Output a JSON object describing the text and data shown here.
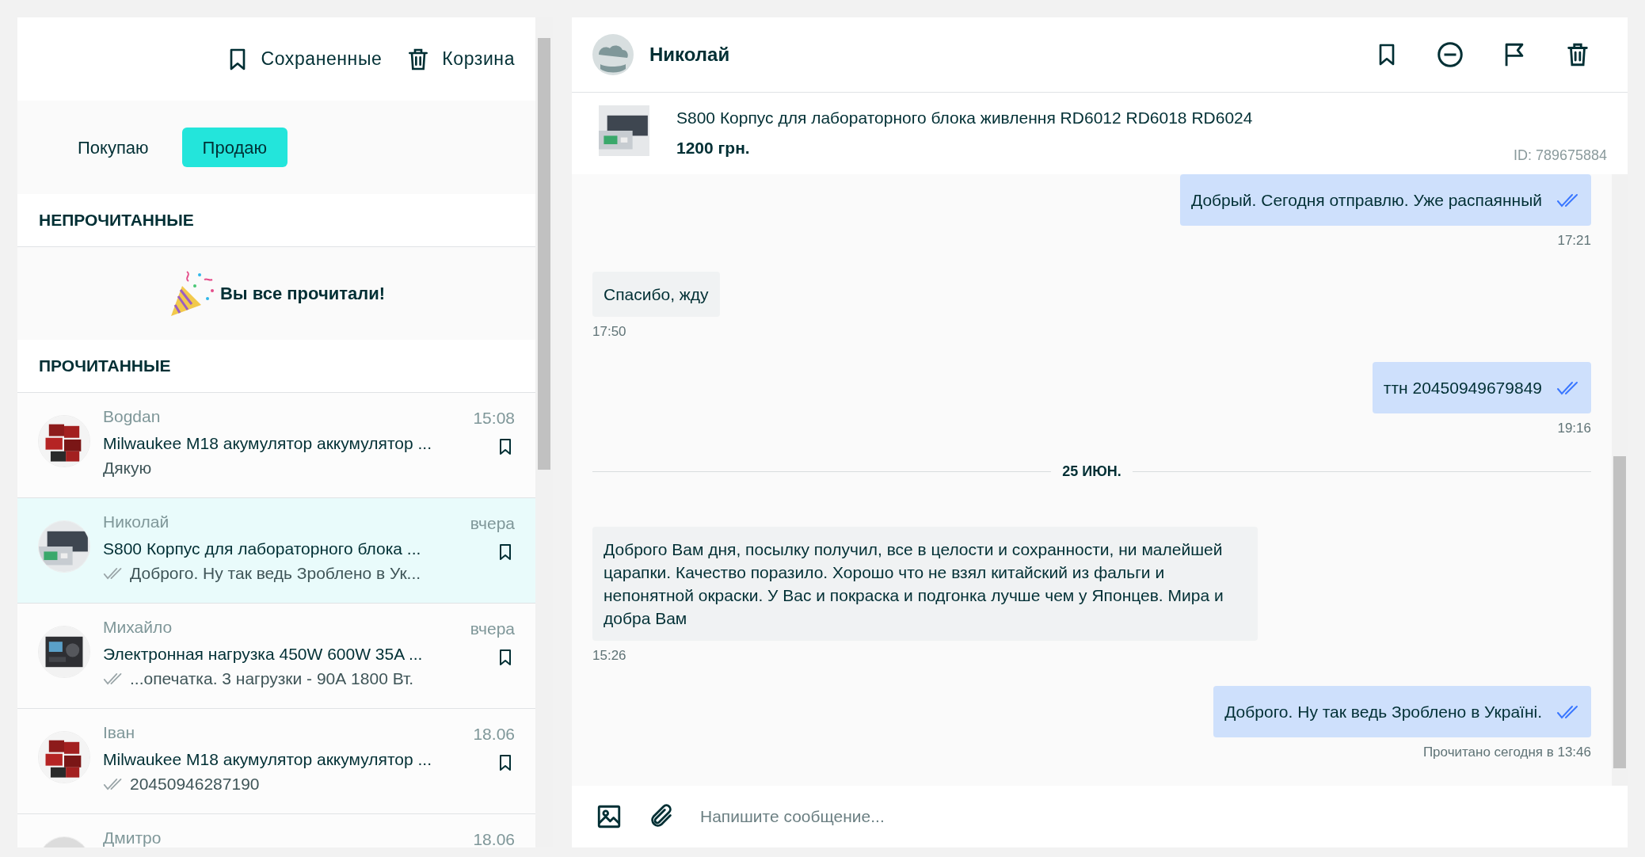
{
  "sidebar": {
    "links": [
      {
        "kind": "bookmark",
        "label": "Сохраненные"
      },
      {
        "kind": "trash",
        "label": "Корзина"
      }
    ],
    "tabs": [
      {
        "label": "Покупаю",
        "selected": false
      },
      {
        "label": "Продаю",
        "selected": true
      }
    ],
    "unread_heading": "НЕПРОЧИТАННЫЕ",
    "all_read_text": "Вы все прочитали!",
    "read_heading": "ПРОЧИТАННЫЕ",
    "conversations": [
      {
        "name": "Bogdan",
        "time": "15:08",
        "title": "Milwaukee M18 акумулятор аккумулятор ...",
        "last": "Дякую",
        "ticked": false,
        "selected": false
      },
      {
        "name": "Николай",
        "time": "вчера",
        "title": "S800 Корпус для лабораторного блока ...",
        "last": "Доброго. Ну так ведь Зроблено в Ук...",
        "ticked": true,
        "selected": true
      },
      {
        "name": "Михайло",
        "time": "вчера",
        "title": "Электронная нагрузка 450W 600W 35A ...",
        "last": "...опечатка. 3 нагрузки - 90А 1800 Вт.",
        "ticked": true,
        "selected": false
      },
      {
        "name": "Іван",
        "time": "18.06",
        "title": "Milwaukee M18 акумулятор аккумулятор ...",
        "last": "20450946287190",
        "ticked": true,
        "selected": false
      },
      {
        "name": "Дмитро",
        "time": "18.06",
        "selected": false
      }
    ]
  },
  "chat": {
    "contact": "Николай",
    "product": {
      "title": "S800 Корпус для лабораторного блока живлення RD6012 RD6018 RD6024",
      "price": "1200 грн.",
      "id": "ID: 789675884"
    },
    "messages": [
      {
        "kind": "out",
        "text": "Добрый. Сегодня отправлю. Уже распаянный",
        "meta": "17:21",
        "read": true
      },
      {
        "kind": "in",
        "text": "Спасибо, жду",
        "meta": "17:50"
      },
      {
        "kind": "out",
        "text": "ттн 20450949679849",
        "meta": "19:16",
        "read": true
      },
      {
        "kind": "date",
        "text": "25 ИЮН."
      },
      {
        "kind": "in",
        "text": "Доброго Вам дня, посылку получил, все в целости и сохранности, ни малейшей царапки. Качество поразило. Хорошо что не взял китайский из фальги и непонятной окраски. У Вас и покраска и подгонка лучше чем у Японцев. Мира и добра Вам",
        "meta": "15:26"
      },
      {
        "kind": "out",
        "text": "Доброго. Ну так ведь Зроблено в Україні.",
        "meta": "Прочитано сегодня в 13:46",
        "read": true
      }
    ],
    "composer": {
      "placeholder": "Напишите сообщение..."
    }
  }
}
